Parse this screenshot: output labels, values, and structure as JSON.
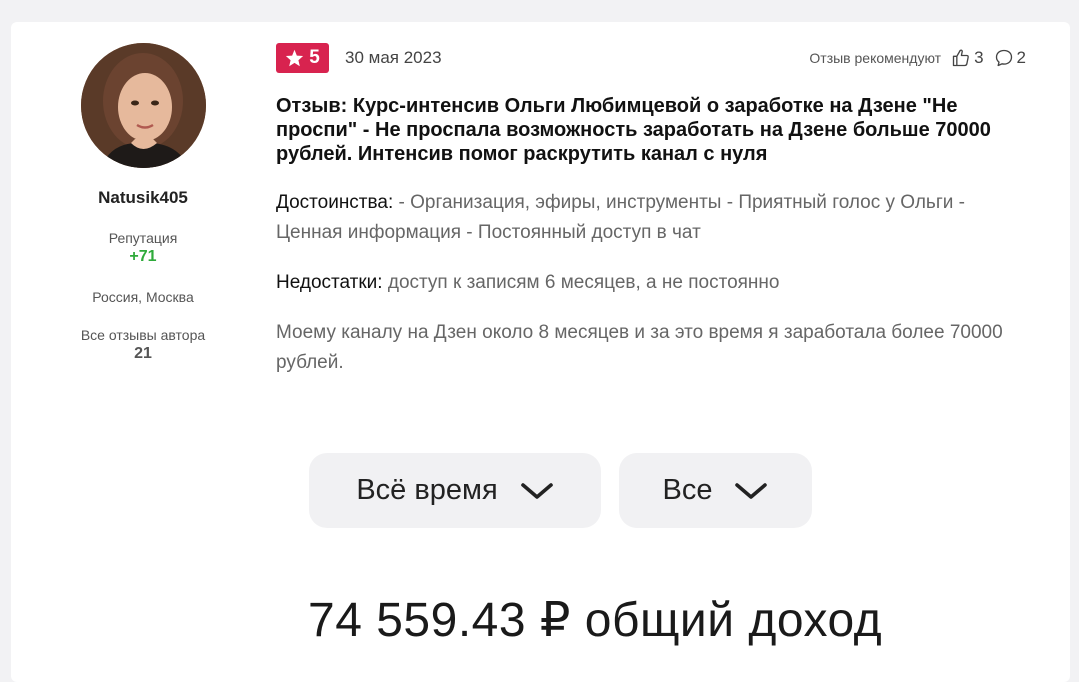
{
  "author": {
    "username": "Natusik405",
    "reputation_label": "Репутация",
    "reputation_value": "+71",
    "location": "Россия, Москва",
    "all_reviews_label": "Все отзывы автора",
    "all_reviews_count": "21"
  },
  "review": {
    "rating": "5",
    "date": "30 мая 2023",
    "recommend_label": "Отзыв рекомендуют",
    "likes": "3",
    "comments": "2",
    "title": "Отзыв: Курс-интенсив Ольги Любимцевой о заработке на Дзене \"Не проспи\" - Не проспала возможность заработать на Дзене больше 70000 рублей. Интенсив помог раскрутить канал с нуля",
    "pros_label": "Достоинства:",
    "pros_text": " - Организация, эфиры, инструменты - Приятный голос у Ольги - Ценная информация - Постоянный доступ в чат",
    "cons_label": "Недостатки:",
    "cons_text": " доступ к записям 6 месяцев, а не постоянно",
    "body": "Моему каналу на Дзен около 8 месяцев и за это время я заработала более 70000 рублей."
  },
  "embedded_image": {
    "filter_period": "Всё время",
    "filter_type": "Все",
    "income_text": "74 559.43 ₽ общий доход"
  },
  "colors": {
    "rating_badge": "#d8234f",
    "reputation": "#2eaa3a"
  },
  "icons": {
    "rating": "star-icon",
    "likes": "thumb-up-icon",
    "comments": "comment-bubble-icon",
    "dropdown": "chevron-down-icon"
  }
}
